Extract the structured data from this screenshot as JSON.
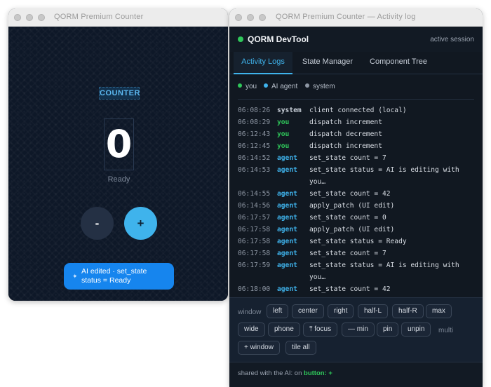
{
  "counter_window": {
    "title": "QORM Premium Counter",
    "label": "COUNTER",
    "value": "0",
    "status": "Ready",
    "decrement_label": "-",
    "increment_label": "+",
    "toast_text": "AI edited · set_state status = Ready"
  },
  "devtool_window": {
    "title": "QORM Premium Counter — Activity log",
    "app_name": "QORM DevTool",
    "session": "active session",
    "tabs": [
      {
        "label": "Activity Logs",
        "active": true
      },
      {
        "label": "State Manager",
        "active": false
      },
      {
        "label": "Component Tree",
        "active": false
      }
    ],
    "legend": [
      {
        "label": "you",
        "color": "#2fc75a"
      },
      {
        "label": "AI agent",
        "color": "#3fb3ec"
      },
      {
        "label": "system",
        "color": "#8e97a4"
      }
    ],
    "logs": [
      {
        "time": "06:08:26",
        "actor": "system",
        "message": "client connected (local)"
      },
      {
        "time": "06:08:29",
        "actor": "you",
        "message": "dispatch increment"
      },
      {
        "time": "06:12:43",
        "actor": "you",
        "message": "dispatch decrement"
      },
      {
        "time": "06:12:45",
        "actor": "you",
        "message": "dispatch increment"
      },
      {
        "time": "06:14:52",
        "actor": "agent",
        "message": "set_state count = 7"
      },
      {
        "time": "06:14:53",
        "actor": "agent",
        "message": "set_state status = AI is editing with you…"
      },
      {
        "time": "06:14:55",
        "actor": "agent",
        "message": "set_state count = 42"
      },
      {
        "time": "06:14:56",
        "actor": "agent",
        "message": "apply_patch (UI edit)"
      },
      {
        "time": "06:17:57",
        "actor": "agent",
        "message": "set_state count = 0"
      },
      {
        "time": "06:17:58",
        "actor": "agent",
        "message": "apply_patch (UI edit)"
      },
      {
        "time": "06:17:58",
        "actor": "agent",
        "message": "set_state status = Ready"
      },
      {
        "time": "06:17:58",
        "actor": "agent",
        "message": "set_state count = 7"
      },
      {
        "time": "06:17:59",
        "actor": "agent",
        "message": "set_state status = AI is editing with you…"
      },
      {
        "time": "06:18:00",
        "actor": "agent",
        "message": "set_state count = 42"
      }
    ],
    "controls": {
      "window_label": "window",
      "multi_label": "multi",
      "buttons": {
        "left": "left",
        "center": "center",
        "right": "right",
        "half_l": "half-L",
        "half_r": "half-R",
        "max": "max",
        "wide": "wide",
        "phone": "phone",
        "focus": "⤒ focus",
        "min": "— min",
        "pin": "pin",
        "unpin": "unpin",
        "add_window": "+ window",
        "tile_all": "tile all"
      }
    },
    "footer": {
      "prefix": "shared with the AI: on ",
      "highlight": "button: +"
    }
  }
}
